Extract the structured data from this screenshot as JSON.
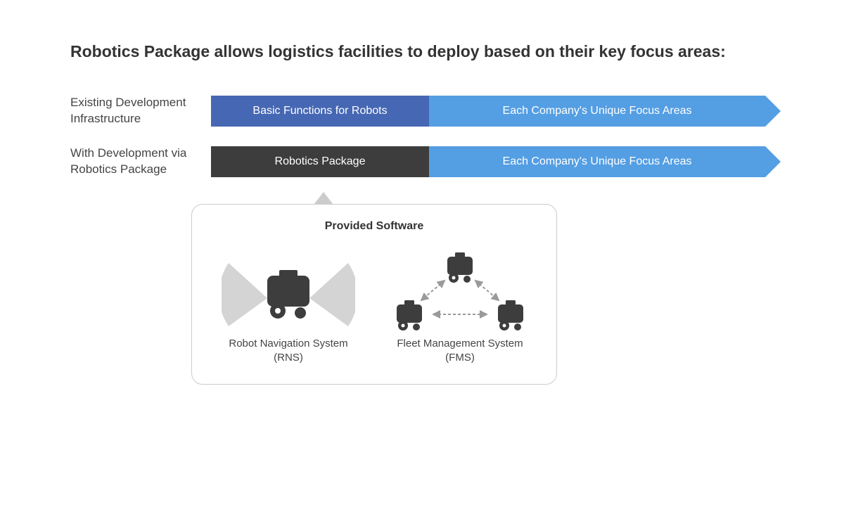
{
  "title": "Robotics Package allows logistics facilities to deploy based on their key focus areas:",
  "rows": [
    {
      "label": "Existing Development Infrastructure",
      "seg1": "Basic Functions for Robots",
      "seg2": "Each Company's Unique Focus Areas"
    },
    {
      "label": "With Development via Robotics Package",
      "seg1": "Robotics Package",
      "seg2": "Each Company's Unique Focus Areas"
    }
  ],
  "callout": {
    "title": "Provided Software",
    "items": [
      {
        "label_line1": "Robot Navigation System",
        "label_line2": "(RNS)"
      },
      {
        "label_line1": "Fleet Management System",
        "label_line2": "(FMS)"
      }
    ]
  }
}
